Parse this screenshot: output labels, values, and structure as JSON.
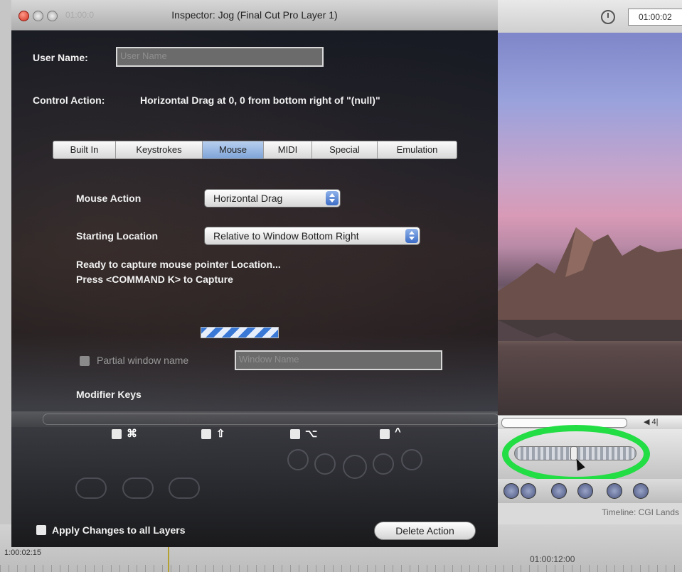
{
  "inspector": {
    "title": "Inspector: Jog (Final Cut Pro Layer 1)",
    "ghost_timecode": "01:00:0",
    "user_name_label": "User Name:",
    "user_name_placeholder": "User Name",
    "control_action_label": "Control Action:",
    "control_action_value": "Horizontal Drag at 0, 0 from bottom right of \"(null)\"",
    "tabs": [
      {
        "label": "Built In"
      },
      {
        "label": "Keystrokes"
      },
      {
        "label": "Mouse",
        "selected": true
      },
      {
        "label": "MIDI"
      },
      {
        "label": "Special"
      },
      {
        "label": "Emulation"
      }
    ],
    "mouse_action_label": "Mouse Action",
    "mouse_action_value": "Horizontal Drag",
    "starting_location_label": "Starting Location",
    "starting_location_value": "Relative to Window Bottom Right",
    "capture_msg_1": "Ready to capture mouse pointer Location...",
    "capture_msg_2": "Press <COMMAND K> to Capture",
    "partial_window_label": "Partial window name",
    "window_name_placeholder": "Window Name",
    "modifier_keys_label": "Modifier Keys",
    "modifiers": [
      {
        "symbol": "⌘",
        "name": "command"
      },
      {
        "symbol": "⇧",
        "name": "shift"
      },
      {
        "symbol": "⌥",
        "name": "option"
      },
      {
        "symbol": "^",
        "name": "control"
      }
    ],
    "apply_all_label": "Apply Changes to all Layers",
    "delete_action_label": "Delete Action"
  },
  "viewer": {
    "timecode": "01:00:02",
    "scrub_end_label": "◀ 4|",
    "timeline_label": "Timeline: CGI Lands",
    "timeline_tc_left": "1:00:02:15",
    "timeline_tc_right": "01:00:12:00"
  },
  "colors": {
    "highlight_ring": "#22dd44",
    "selected_tab": "#7ea4d8",
    "close_button": "#d1301f"
  }
}
